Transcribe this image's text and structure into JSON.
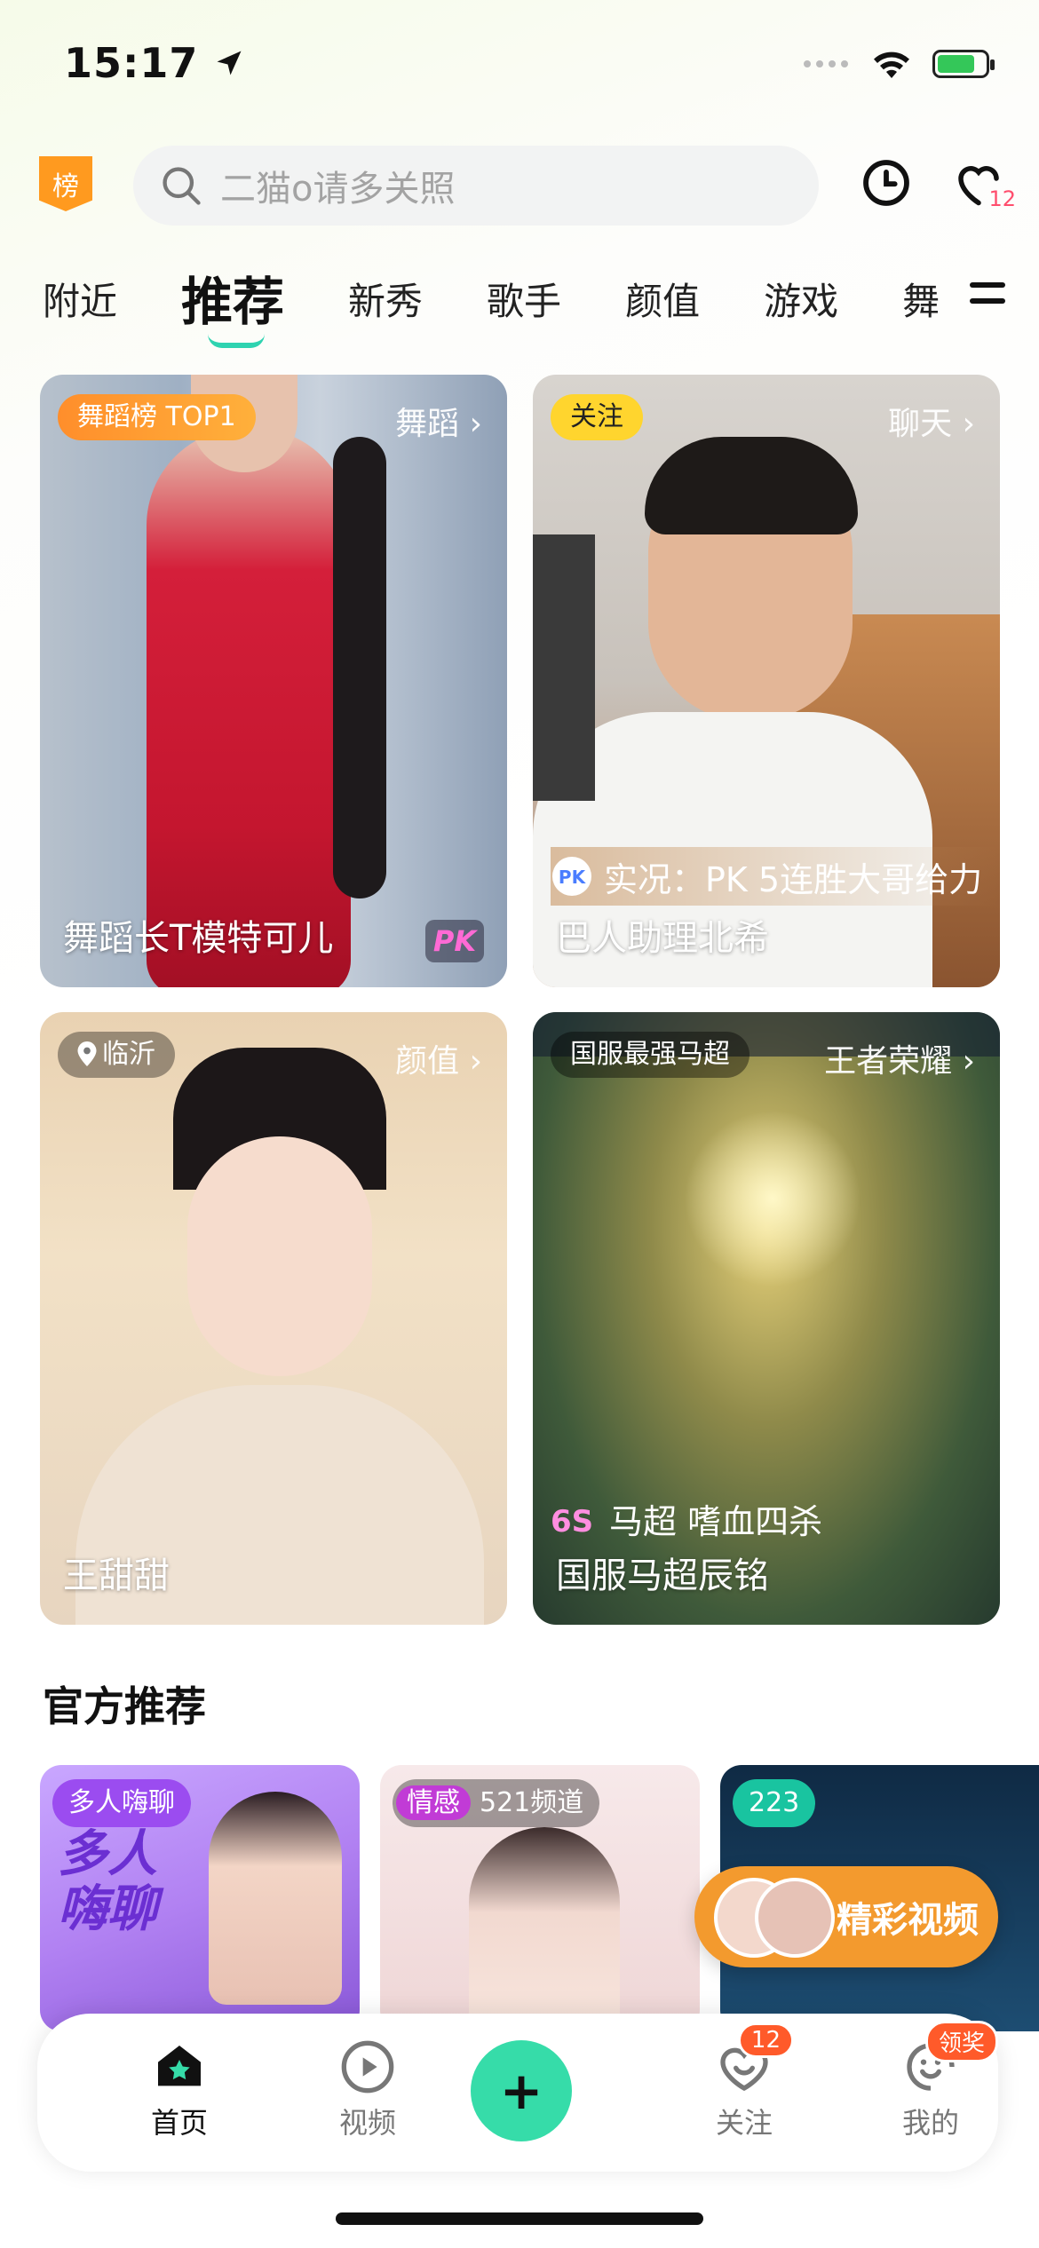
{
  "status_bar": {
    "time": "15:17"
  },
  "top_bar": {
    "rank_badge": "榜",
    "search_placeholder": "二猫o请多关照",
    "follow_badge": "12"
  },
  "tabs": [
    "附近",
    "推荐",
    "新秀",
    "歌手",
    "颜值",
    "游戏",
    "舞"
  ],
  "active_tab": "推荐",
  "cards": [
    {
      "tag": "舞蹈榜 TOP1",
      "category": "舞蹈 ›",
      "title": "舞蹈长T模特可儿",
      "badge": "PK"
    },
    {
      "tag": "关注",
      "category": "聊天 ›",
      "subtitle": "实况：PK 5连胜大哥给力",
      "title": "巴人助理北希"
    },
    {
      "tag": "临沂",
      "category": "颜值 ›",
      "title": "王甜甜"
    },
    {
      "tag": "国服最强马超",
      "category": "王者荣耀 ›",
      "subtitle": "马超 嗜血四杀",
      "title": "国服马超辰铭"
    }
  ],
  "section": {
    "title": "官方推荐"
  },
  "recommend": [
    {
      "tag": "多人嗨聊",
      "art_text": "多人嗨聊"
    },
    {
      "tag": "情感",
      "tag2": "521频道"
    },
    {
      "tag": "223"
    }
  ],
  "float_button": {
    "label": "精彩视频"
  },
  "nav": {
    "items": [
      {
        "label": "首页"
      },
      {
        "label": "视频"
      },
      {
        "label": "关注",
        "badge": "12"
      },
      {
        "label": "我的",
        "badge": "领奖"
      }
    ]
  },
  "colors": {
    "accent": "#36dca9",
    "orange": "#f39a2e",
    "badge_red": "#ff5a2a"
  }
}
